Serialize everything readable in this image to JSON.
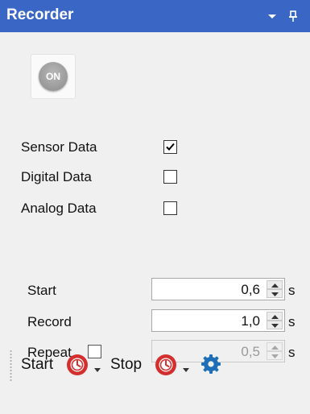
{
  "window": {
    "title": "Recorder",
    "title_bar_color": "#3a67c6"
  },
  "power_button": {
    "label": "ON",
    "state_color": "#9d9d9d"
  },
  "data_sources": [
    {
      "label": "Sensor Data",
      "checked": true
    },
    {
      "label": "Digital Data",
      "checked": false
    },
    {
      "label": "Analog Data",
      "checked": false
    }
  ],
  "timing": {
    "start": {
      "label": "Start",
      "value": "0,6",
      "unit": "s"
    },
    "record": {
      "label": "Record",
      "value": "1,0",
      "unit": "s"
    },
    "repeat": {
      "label": "Repeat",
      "value": "0,5",
      "unit": "s",
      "checked": false,
      "enabled": false
    }
  },
  "toolbar": {
    "start_label": "Start",
    "stop_label": "Stop",
    "record_icon_color": "#d32f2f",
    "gear_color": "#1e6fb5"
  },
  "icons": {
    "dropdown": "chevron-down-icon",
    "pin": "pin-icon",
    "record": "timer-icon",
    "settings": "gear-icon"
  }
}
